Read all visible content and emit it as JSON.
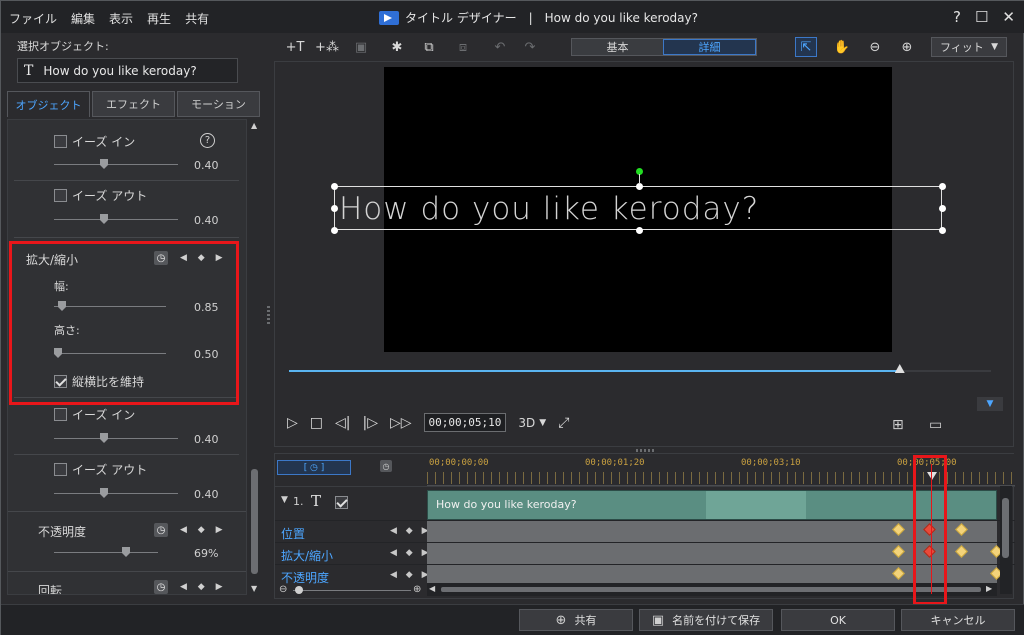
{
  "menu": [
    "ファイル",
    "編集",
    "表示",
    "再生",
    "共有"
  ],
  "window": {
    "title": "タイトル デザイナー",
    "separator": "|",
    "doc_title": "How do you like keroday?",
    "help": "?",
    "maximize": "☐",
    "close": "✕"
  },
  "left": {
    "selected_label": "選択オブジェクト:",
    "selected_icon": "T",
    "selected_value": "How do you like keroday?",
    "tabs": [
      "オブジェクト",
      "エフェクト",
      "モーション"
    ],
    "ease_in_1": "イーズ イン",
    "ease_in_1_val": "0.40",
    "ease_out_1": "イーズ アウト",
    "ease_out_1_val": "0.40",
    "scale_title": "拡大/縮小",
    "width_label": "幅:",
    "width_val": "0.85",
    "height_label": "高さ:",
    "height_val": "0.50",
    "keep_ratio": "縦横比を維持",
    "ease_in_2": "イーズ イン",
    "ease_in_2_val": "0.40",
    "ease_out_2": "イーズ アウト",
    "ease_out_2_val": "0.40",
    "opacity_title": "不透明度",
    "opacity_val": "69%",
    "rotate_title": "回転",
    "help_icon": "?",
    "kf_nav": "◀ ◆ ▶"
  },
  "toolbar": {
    "mode_basic": "基本",
    "mode_detail": "詳細",
    "fit": "フィット",
    "fit_arrow": "▼"
  },
  "preview": {
    "text": "How do you like keroday?",
    "timecode": "00;00;05;10",
    "mode3d": "3D",
    "progress": 0.87
  },
  "timeline": {
    "marks": [
      "00;00;00;00",
      "00;00;01;20",
      "00;00;03;10",
      "00;00;05;00"
    ],
    "track_num": "1.",
    "track_icon": "T",
    "clip_text": "How do you like keroday?",
    "rows": [
      "位置",
      "拡大/縮小",
      "不透明度"
    ],
    "kf_nav": "◀ ◆ ▶"
  },
  "footer": {
    "share": "共有",
    "save_as": "名前を付けて保存",
    "ok": "OK",
    "cancel": "キャンセル"
  },
  "colors": {
    "accent": "#4da6ff",
    "highlight": "#e8161a",
    "keyframe": "#f3d37a",
    "keyframe_active": "#e84a3a",
    "clip": "#5a8e82"
  }
}
